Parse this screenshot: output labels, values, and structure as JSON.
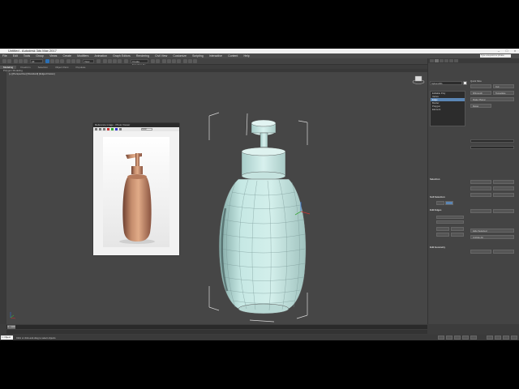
{
  "window": {
    "title": "Untitled - Autodesk 3ds Max 2017",
    "search_placeholder": "Type a keyword or phrase"
  },
  "menu": [
    "File",
    "Edit",
    "Tools",
    "Group",
    "Views",
    "Create",
    "Modifiers",
    "Animation",
    "Graph Editors",
    "Rendering",
    "Civil View",
    "Customize",
    "Scripting",
    "Interactive",
    "Content",
    "Help"
  ],
  "toolbar": {
    "selection_filter": "All",
    "view_dropdown": "View",
    "named_sets": "Create Selection Se"
  },
  "ribbon": {
    "tabs": [
      "Modeling",
      "Freeform",
      "Selection",
      "Object Paint",
      "Populate"
    ],
    "sub": "Polygon Modeling"
  },
  "viewport": {
    "label": "[+] [Perspective] [Standard] [Edged Faces]"
  },
  "reference": {
    "title": "Reference image - Photo Viewer",
    "dropdown": "Color"
  },
  "timeline": {
    "frame": "0 / 100"
  },
  "status": {
    "selection": "1 Object Selected",
    "hint": "Click or click-and-drag to select objects"
  },
  "command_panel": {
    "object_name": "Sphere001",
    "list": [
      "Editable Poly",
      "Vertex",
      "Edge",
      "Border",
      "Polygon",
      "Element"
    ],
    "rollouts": [
      "Selection",
      "Soft Selection",
      "Edit Edges",
      "Edit Geometry"
    ],
    "right_column": [
      "Quick Slice",
      "Cut",
      "MSmooth",
      "Tessellate",
      "Make Planar",
      "Relax",
      "Hide Selected",
      "Unhide All"
    ]
  },
  "colors": {
    "viewport": "#464646",
    "model": "#bfe3df",
    "accent": "#2a6fb5",
    "photo_copper": "#b07a5c"
  }
}
